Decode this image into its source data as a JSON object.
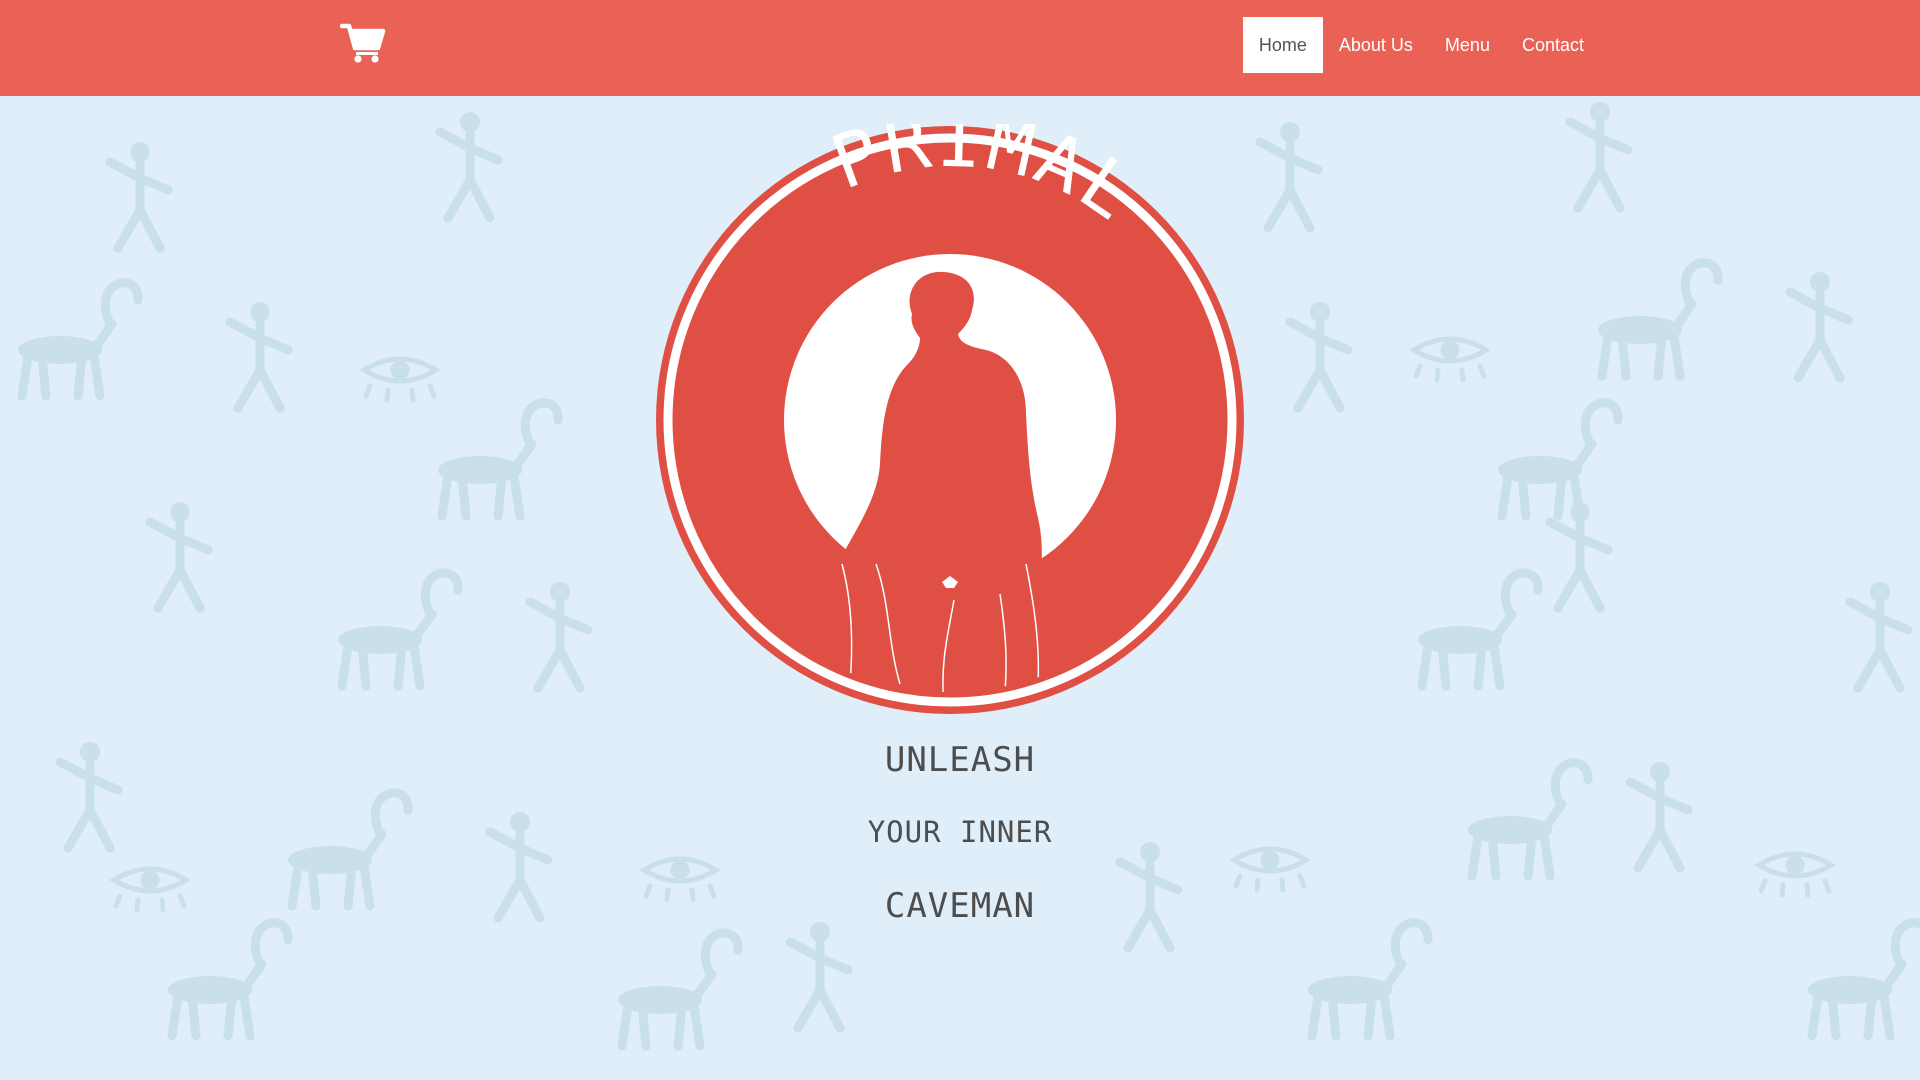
{
  "colors": {
    "brand": "#ea6155",
    "logo_red": "#e04f43",
    "background": "#dfeef9",
    "pattern": "#c9dfec",
    "active_bg": "#ffffff",
    "active_text": "#555555",
    "tagline": "#4d4d4d"
  },
  "header": {
    "cart_icon": "shopping-cart-icon",
    "nav": [
      {
        "label": "Home",
        "active": true
      },
      {
        "label": "About Us",
        "active": false
      },
      {
        "label": "Menu",
        "active": false
      },
      {
        "label": "Contact",
        "active": false
      }
    ]
  },
  "hero": {
    "logo_text": "PRIMAL",
    "logo_figure": "caveman-silhouette",
    "tagline_line1": "UNLEASH",
    "tagline_line2": "YOUR INNER",
    "tagline_line3": "CAVEMAN"
  }
}
